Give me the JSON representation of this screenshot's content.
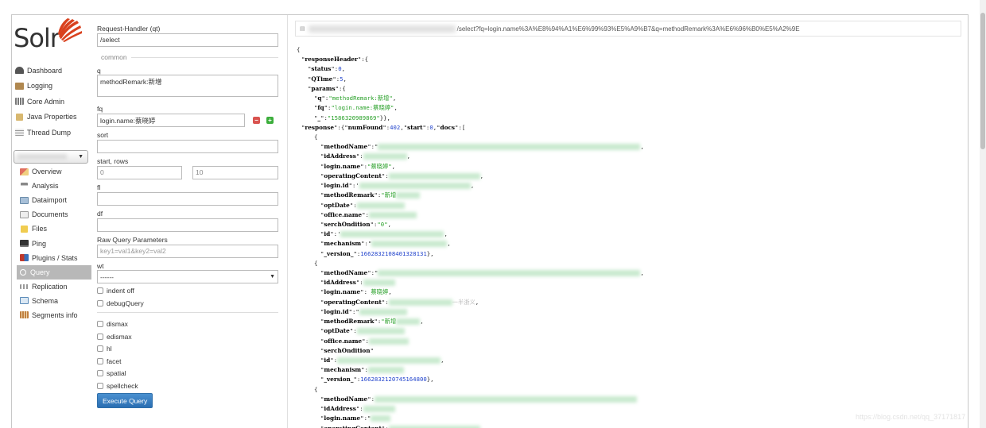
{
  "logo": {
    "text": "Solr"
  },
  "nav": [
    {
      "label": "Dashboard",
      "icon": "dashboard-icon",
      "color": "#555555"
    },
    {
      "label": "Logging",
      "icon": "logging-icon",
      "color": "#8a6a3a"
    },
    {
      "label": "Core Admin",
      "icon": "core-admin-icon",
      "color": "#7a7a7a"
    },
    {
      "label": "Java Properties",
      "icon": "java-properties-icon",
      "color": "#c0a060"
    },
    {
      "label": "Thread Dump",
      "icon": "thread-dump-icon",
      "color": "#999999"
    }
  ],
  "core_nav": [
    {
      "label": "Overview",
      "icon": "overview-icon",
      "color": "#d9534f"
    },
    {
      "label": "Analysis",
      "icon": "analysis-icon",
      "color": "#888888"
    },
    {
      "label": "Dataimport",
      "icon": "dataimport-icon",
      "color": "#6a8caa"
    },
    {
      "label": "Documents",
      "icon": "documents-icon",
      "color": "#aaaaaa"
    },
    {
      "label": "Files",
      "icon": "files-icon",
      "color": "#e8c24a"
    },
    {
      "label": "Ping",
      "icon": "ping-icon",
      "color": "#444444"
    },
    {
      "label": "Plugins / Stats",
      "icon": "plugins-icon",
      "color": "#c0392b"
    },
    {
      "label": "Query",
      "icon": "query-icon",
      "color": "#ffffff",
      "active": true
    },
    {
      "label": "Replication",
      "icon": "replication-icon",
      "color": "#999999"
    },
    {
      "label": "Schema",
      "icon": "schema-icon",
      "color": "#5a8ab8"
    },
    {
      "label": "Segments info",
      "icon": "segments-icon",
      "color": "#c08040"
    }
  ],
  "form": {
    "qt_label": "Request-Handler (qt)",
    "qt_value": "/select",
    "common_label": "common",
    "q_label": "q",
    "q_value": "methodRemark:新增",
    "fq_label": "fq",
    "fq_value": "login.name:蔡晓婷",
    "sort_label": "sort",
    "rows_label": "start, rows",
    "start_value": "0",
    "rows_value": "10",
    "fl_label": "fl",
    "df_label": "df",
    "raw_label": "Raw Query Parameters",
    "raw_placeholder": "key1=val1&key2=val2",
    "wt_label": "wt",
    "wt_value": "------",
    "indent_label": "indent off",
    "debug_label": "debugQuery",
    "dismax_label": "dismax",
    "edismax_label": "edismax",
    "hl_label": "hl",
    "facet_label": "facet",
    "spatial_label": "spatial",
    "spellcheck_label": "spellcheck",
    "execute_label": "Execute Query"
  },
  "url": {
    "path": "/select?fq=login.name%3A%E8%94%A1%E6%99%93%E5%A9%B7&q=methodRemark%3A%E6%96%B0%E5%A2%9E"
  },
  "response": {
    "responseHeader": "responseHeader",
    "status_key": "status",
    "status_val": "0",
    "qtime_key": "QTime",
    "qtime_val": "5",
    "params_key": "params",
    "q_key": "q",
    "q_val": "\"methodRemark:新增\"",
    "fq_key": "fq",
    "fq_val": "\"login.name:蔡晓婷\"",
    "ts_key": "_",
    "ts_val": "\"1586320989869\"",
    "response_key": "response",
    "numfound_key": "numFound",
    "numfound_val": "402",
    "start_key": "start",
    "start_val": "0",
    "docs_key": "docs",
    "doc1": {
      "methodName": "methodName",
      "idAddress": "idAddress",
      "loginName": "login.name",
      "loginName_val": "\"蔡晓婷\"",
      "operatingContent": "operatingContent",
      "loginId": "login.id",
      "methodRemark": "methodRemark",
      "methodRemark_val": "\"新增",
      "optDate": "optDate",
      "officeName": "office.name",
      "serchOndition": "serchOndition",
      "serchOndition_val": "\"0\"",
      "id": "id",
      "mechanism": "mechanism",
      "version": "_version_",
      "version_val": "1662832108401328131"
    },
    "doc2": {
      "methodName": "methodName",
      "idAddress": "idAddress",
      "loginName": "login.name",
      "loginName_val": "蔡晓婷",
      "operatingContent": "operatingContent",
      "operatingContent_tail": "一半浙义",
      "loginId": "login.id",
      "methodRemark": "methodRemark",
      "methodRemark_val": "\"新增",
      "optDate": "optDate",
      "officeName": "office.name",
      "serchOndition": "serchOndition",
      "id": "id",
      "mechanism": "mechanism",
      "version": "_version_",
      "version_val": "1662832120745164800"
    },
    "doc3": {
      "methodName": "methodName",
      "idAddress": "idAddress",
      "loginName": "login.name",
      "operatingContent": "operatingContent"
    }
  },
  "watermark": "https://blog.csdn.net/qq_37171817"
}
